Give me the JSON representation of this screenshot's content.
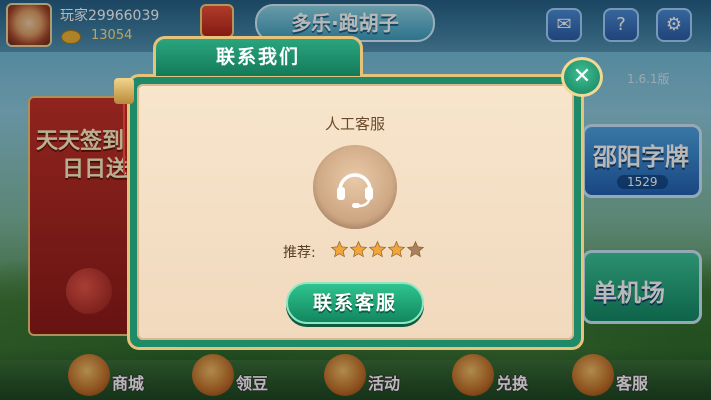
{
  "header": {
    "player_name": "玩家29966039",
    "coins": "13054",
    "game_title": "多乐·跑胡子",
    "mail_icon": "mail-icon",
    "help_icon": "help-icon",
    "settings_icon": "gear-icon"
  },
  "version": "1.6.1版",
  "banner": {
    "line1": "天天签到",
    "line2": "日日送"
  },
  "side_buttons": [
    {
      "label": "邵阳字牌",
      "count": "1529"
    },
    {
      "label": "单机场"
    }
  ],
  "bottom_nav": [
    {
      "label": "商城",
      "icon": "shop-cat-icon"
    },
    {
      "label": "领豆",
      "icon": "bean-bag-icon"
    },
    {
      "label": "活动",
      "icon": "activity-drum-icon"
    },
    {
      "label": "兑换",
      "icon": "exchange-box-icon"
    },
    {
      "label": "客服",
      "icon": "service-girl-icon"
    }
  ],
  "dialog": {
    "title": "联系我们",
    "close_icon": "close-icon",
    "service_label": "人工客服",
    "service_icon": "headset-icon",
    "rating_label": "推荐:",
    "rating": 4,
    "rating_max": 5,
    "contact_button": "联系客服"
  },
  "colors": {
    "accent_green": "#1f8a67",
    "panel_cream": "#f7e5cc",
    "gold_border": "#e7c27a",
    "star_filled": "#f2a53a",
    "star_empty": "#a8825e"
  }
}
